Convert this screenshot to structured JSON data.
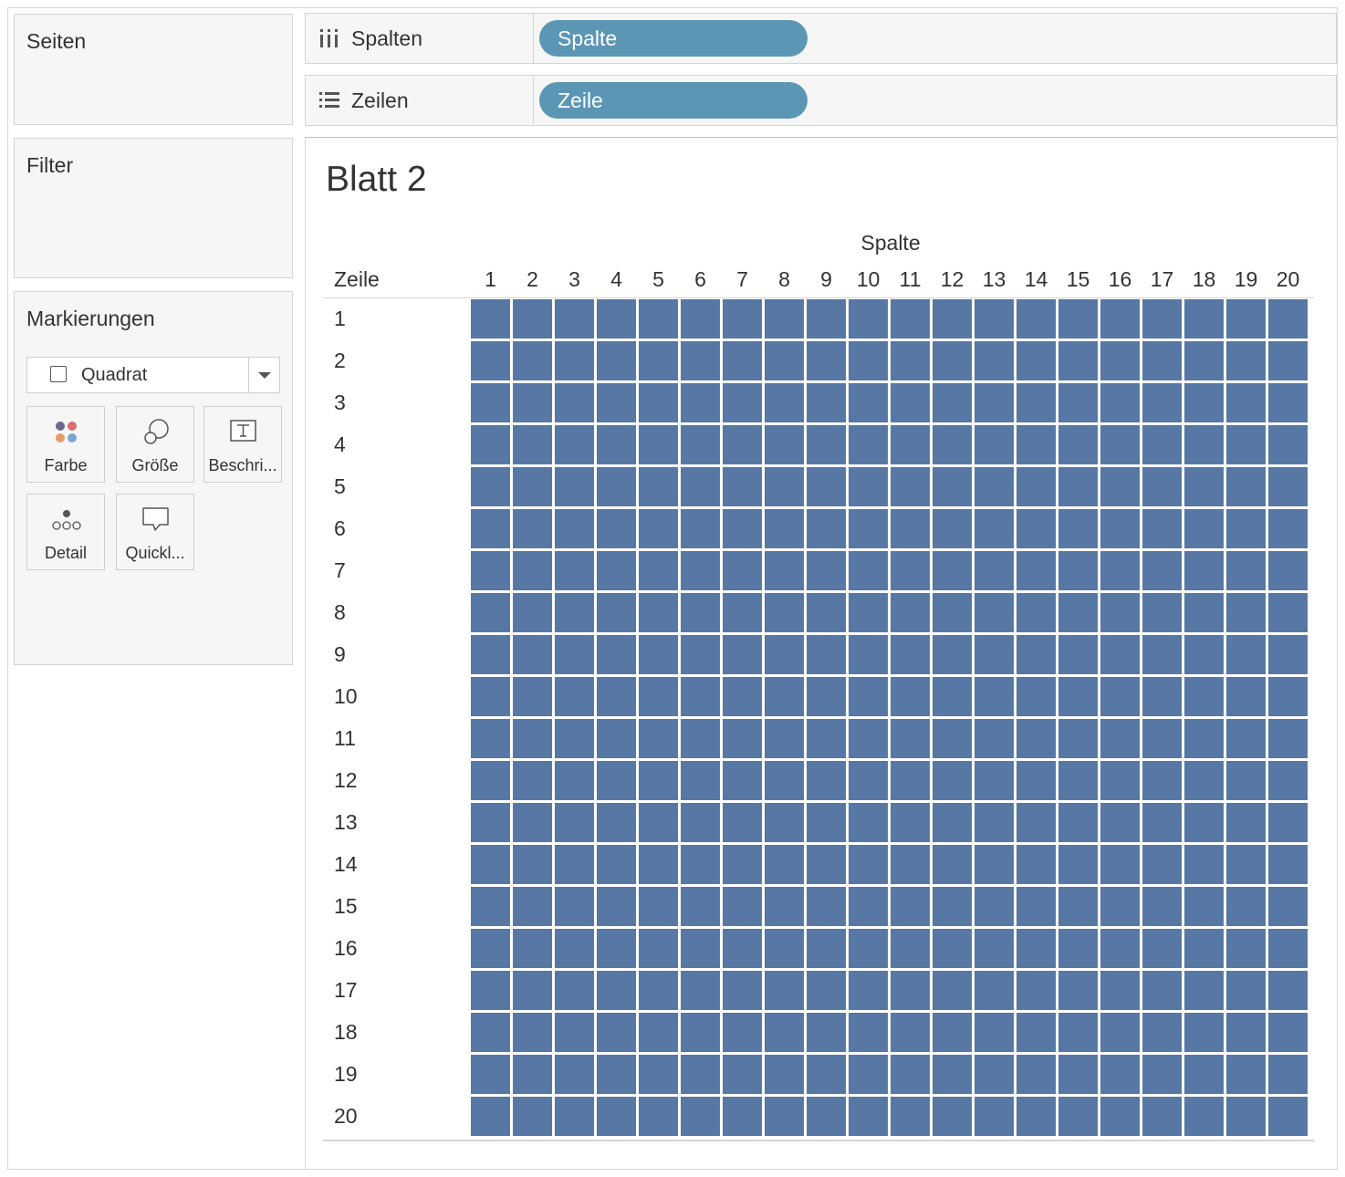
{
  "sidebar": {
    "pages_title": "Seiten",
    "filter_title": "Filter",
    "marks": {
      "title": "Markierungen",
      "mark_type": "Quadrat",
      "buttons": {
        "color": "Farbe",
        "size": "Größe",
        "label": "Beschri...",
        "detail": "Detail",
        "tooltip": "Quickl..."
      }
    }
  },
  "shelves": {
    "columns": {
      "label": "Spalten",
      "pill": "Spalte",
      "icon": "columns-icon"
    },
    "rows": {
      "label": "Zeilen",
      "pill": "Zeile",
      "icon": "rows-icon"
    }
  },
  "sheet": {
    "title": "Blatt 2"
  },
  "colors": {
    "pill": "#5b96b4",
    "mark": "#5778a4",
    "shelf_bg": "#f6f6f6"
  },
  "chart_data": {
    "type": "heatmap",
    "title": "",
    "xlabel": "Spalte",
    "ylabel": "Zeile",
    "x": [
      "1",
      "2",
      "3",
      "4",
      "5",
      "6",
      "7",
      "8",
      "9",
      "10",
      "11",
      "12",
      "13",
      "14",
      "15",
      "16",
      "17",
      "18",
      "19",
      "20"
    ],
    "y": [
      "1",
      "2",
      "3",
      "4",
      "5",
      "6",
      "7",
      "8",
      "9",
      "10",
      "11",
      "12",
      "13",
      "14",
      "15",
      "16",
      "17",
      "18",
      "19",
      "20"
    ],
    "mark": "square",
    "color": "#5778a4"
  }
}
